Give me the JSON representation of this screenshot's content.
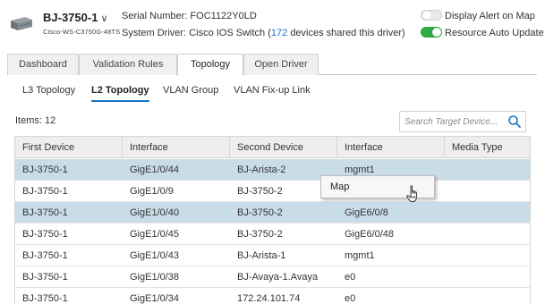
{
  "device": {
    "name": "BJ-3750-1",
    "chevron": "∨",
    "model": "Cisco-WS-C3750G-48TS",
    "serial_label": "Serial Number:",
    "serial_value": "FOC1122Y0LD",
    "driver_label": "System Driver:",
    "driver_value": "Cisco IOS Switch",
    "driver_paren_open": "(",
    "driver_count": "172",
    "driver_suffix": "devices shared this driver)"
  },
  "toggles": [
    {
      "label": "Display Alert on Map",
      "on": false
    },
    {
      "label": "Resource Auto Update",
      "on": true
    }
  ],
  "main_tabs": [
    {
      "label": "Dashboard",
      "active": false
    },
    {
      "label": "Validation Rules",
      "active": false
    },
    {
      "label": "Topology",
      "active": true
    },
    {
      "label": "Open Driver",
      "active": false
    }
  ],
  "sub_tabs": [
    {
      "label": "L3 Topology",
      "active": false
    },
    {
      "label": "L2 Topology",
      "active": true
    },
    {
      "label": "VLAN Group",
      "active": false
    },
    {
      "label": "VLAN Fix-up Link",
      "active": false
    }
  ],
  "items_count": "Items: 12",
  "search": {
    "placeholder": "Search Target Device...",
    "icon": "search-icon"
  },
  "table": {
    "headers": [
      "First Device",
      "Interface",
      "Second Device",
      "Interface",
      "Media Type"
    ],
    "rows": [
      {
        "first_device": "BJ-3750-1",
        "interface1": "GigE1/0/44",
        "second_device": "BJ-Arista-2",
        "interface2": "mgmt1",
        "media": "",
        "selected": true
      },
      {
        "first_device": "BJ-3750-1",
        "interface1": "GigE1/0/9",
        "second_device": "BJ-3750-2",
        "interface2": "",
        "media": "",
        "selected": false
      },
      {
        "first_device": "BJ-3750-1",
        "interface1": "GigE1/0/40",
        "second_device": "BJ-3750-2",
        "interface2": "GigE6/0/8",
        "media": "",
        "selected": true
      },
      {
        "first_device": "BJ-3750-1",
        "interface1": "GigE1/0/45",
        "second_device": "BJ-3750-2",
        "interface2": "GigE6/0/48",
        "media": "",
        "selected": false
      },
      {
        "first_device": "BJ-3750-1",
        "interface1": "GigE1/0/43",
        "second_device": "BJ-Arista-1",
        "interface2": "mgmt1",
        "media": "",
        "selected": false
      },
      {
        "first_device": "BJ-3750-1",
        "interface1": "GigE1/0/38",
        "second_device": "BJ-Avaya-1.Avaya",
        "interface2": "e0",
        "media": "",
        "selected": false
      },
      {
        "first_device": "BJ-3750-1",
        "interface1": "GigE1/0/34",
        "second_device": "172.24.101.74",
        "interface2": "e0",
        "media": "",
        "selected": false
      }
    ]
  },
  "context_menu": {
    "items": [
      "Map"
    ]
  },
  "colors": {
    "accent": "#1a73c8",
    "toggle_on": "#2fa846",
    "row_selected": "#c9dde9"
  }
}
